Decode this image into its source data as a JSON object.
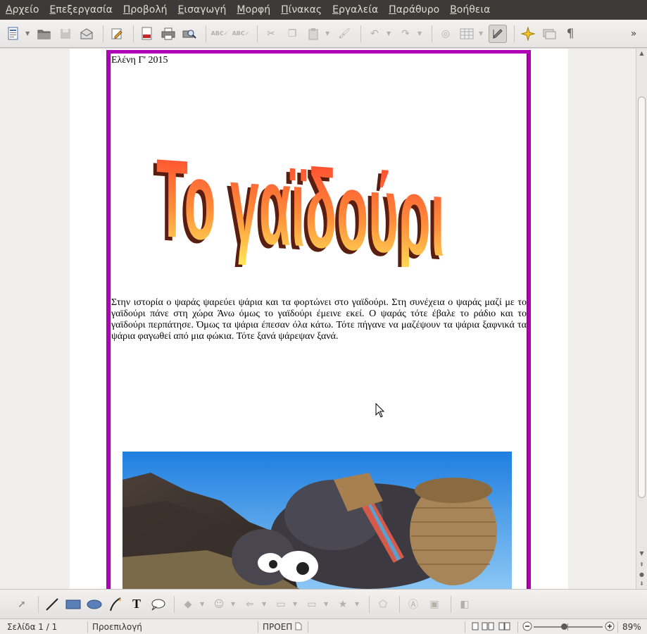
{
  "menu": [
    "Αρχείο",
    "Επεξεργασία",
    "Προβολή",
    "Εισαγωγή",
    "Μορφή",
    "Πίνακας",
    "Εργαλεία",
    "Παράθυρο",
    "Βοήθεια"
  ],
  "toolbar": {
    "icons": [
      "new-document-icon",
      "open-icon",
      "save-icon",
      "email-icon",
      "edit-file-icon",
      "export-pdf-icon",
      "print-icon",
      "print-preview-icon",
      "spellcheck-icon",
      "autospellcheck-icon",
      "cut-icon",
      "copy-icon",
      "paste-icon",
      "clone-formatting-icon",
      "undo-icon",
      "redo-icon",
      "navigator-icon",
      "table-icon",
      "draw-functions-icon",
      "gallery-star-icon",
      "data-sources-icon",
      "pilcrow-icon"
    ],
    "more": "»"
  },
  "document": {
    "header": "Ελένη  Γ'    2015",
    "wordart": "Το γαϊδούρι",
    "body": "Στην ιστορία ο ψαράς ψαρεύει ψάρια και τα φορτώνει στο γαϊδούρι. Στη συνέχεια ο ψαράς μαζί με το γαϊδούρι πάνε στη χώρα Άνω όμως το γαϊδούρι έμεινε εκεί. Ο ψαράς τότε έβαλε το ράδιο και το γαϊδούρι περπάτησε. Όμως τα ψάρια έπεσαν όλα κάτω. Τότε πήγανε να μαζέψουν τα ψάρια ξαφνικά τα ψάρια φαγωθεί από μια φώκια. Τότε ξανά ψάρεψαν ξανά.",
    "frame_color": "#b000b5"
  },
  "drawing_toolbar": [
    "select-arrow-icon",
    "line-icon",
    "rectangle-icon",
    "ellipse-icon",
    "freeform-pen-icon",
    "text-icon",
    "callout-icon",
    "basic-shapes-icon",
    "symbol-shapes-icon",
    "block-arrows-icon",
    "flowchart-icon",
    "callouts-icon",
    "stars-icon",
    "points-icon",
    "fontwork-icon",
    "from-file-icon",
    "extrusion-icon"
  ],
  "status": {
    "page": "Σελίδα 1 / 1",
    "style": "Προεπιλογή",
    "mode": "ΠΡΟΕΠ",
    "zoom": "89%"
  }
}
